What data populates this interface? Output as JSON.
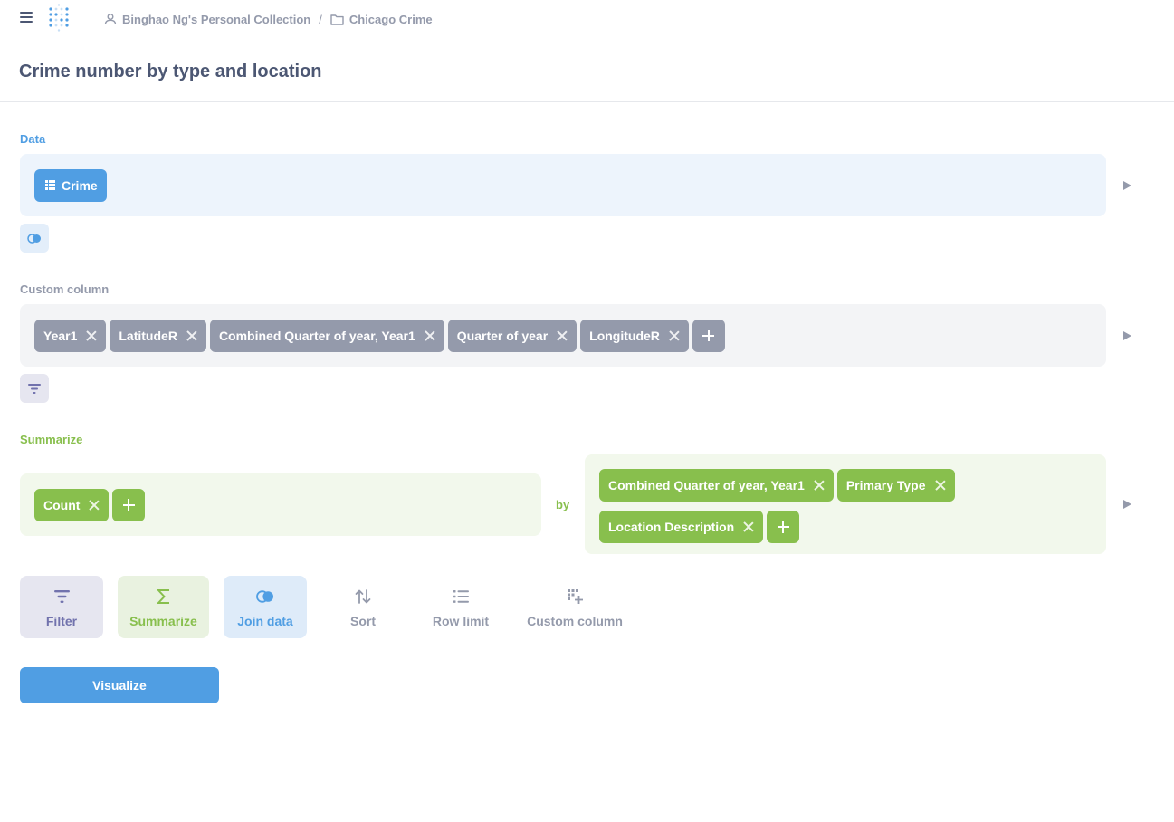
{
  "breadcrumb": {
    "collection": "Binghao Ng's Personal Collection",
    "separator": "/",
    "folder": "Chicago Crime"
  },
  "title": "Crime number by type and location",
  "data_step": {
    "label": "Data",
    "table": "Crime"
  },
  "custom_column_step": {
    "label": "Custom column",
    "columns": [
      "Year1",
      "LatitudeR",
      "Combined Quarter of year, Year1",
      "Quarter of year",
      "LongitudeR"
    ]
  },
  "summarize_step": {
    "label": "Summarize",
    "metrics": [
      "Count"
    ],
    "by_label": "by",
    "breakouts": [
      "Combined Quarter of year, Year1",
      "Primary Type",
      "Location Description"
    ]
  },
  "actions": {
    "filter": "Filter",
    "summarize": "Summarize",
    "join": "Join data",
    "sort": "Sort",
    "row_limit": "Row limit",
    "custom_column": "Custom column"
  },
  "visualize_label": "Visualize",
  "colors": {
    "brand": "#509ee3",
    "custom_column": "#949aab",
    "summarize": "#88bf4d",
    "filter": "#7172ad"
  }
}
